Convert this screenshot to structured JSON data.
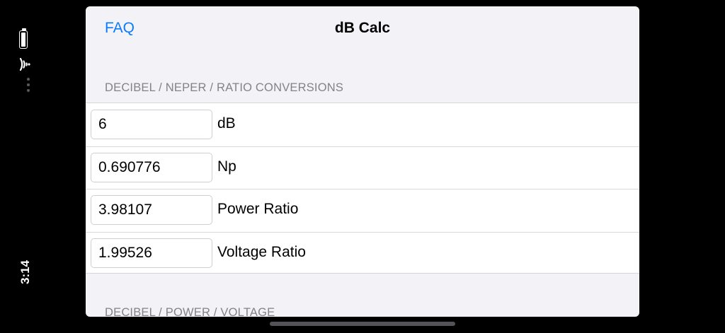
{
  "status": {
    "time": "3:14"
  },
  "nav": {
    "faq_label": "FAQ",
    "title": "dB Calc"
  },
  "sections": [
    {
      "header": "DECIBEL / NEPER / RATIO CONVERSIONS",
      "rows": [
        {
          "value": "6",
          "unit": "dB"
        },
        {
          "value": "0.690776",
          "unit": "Np"
        },
        {
          "value": "3.98107",
          "unit": "Power Ratio"
        },
        {
          "value": "1.99526",
          "unit": "Voltage Ratio"
        }
      ]
    },
    {
      "header": "DECIBEL / POWER / VOLTAGE"
    }
  ],
  "icons": {
    "battery": "battery-icon",
    "wifi": "wifi-icon",
    "grabber": "grabber-icon"
  },
  "colors": {
    "accent": "#0a7aff",
    "sheet_background": "#f2f2f7",
    "section_header": "#828289"
  }
}
